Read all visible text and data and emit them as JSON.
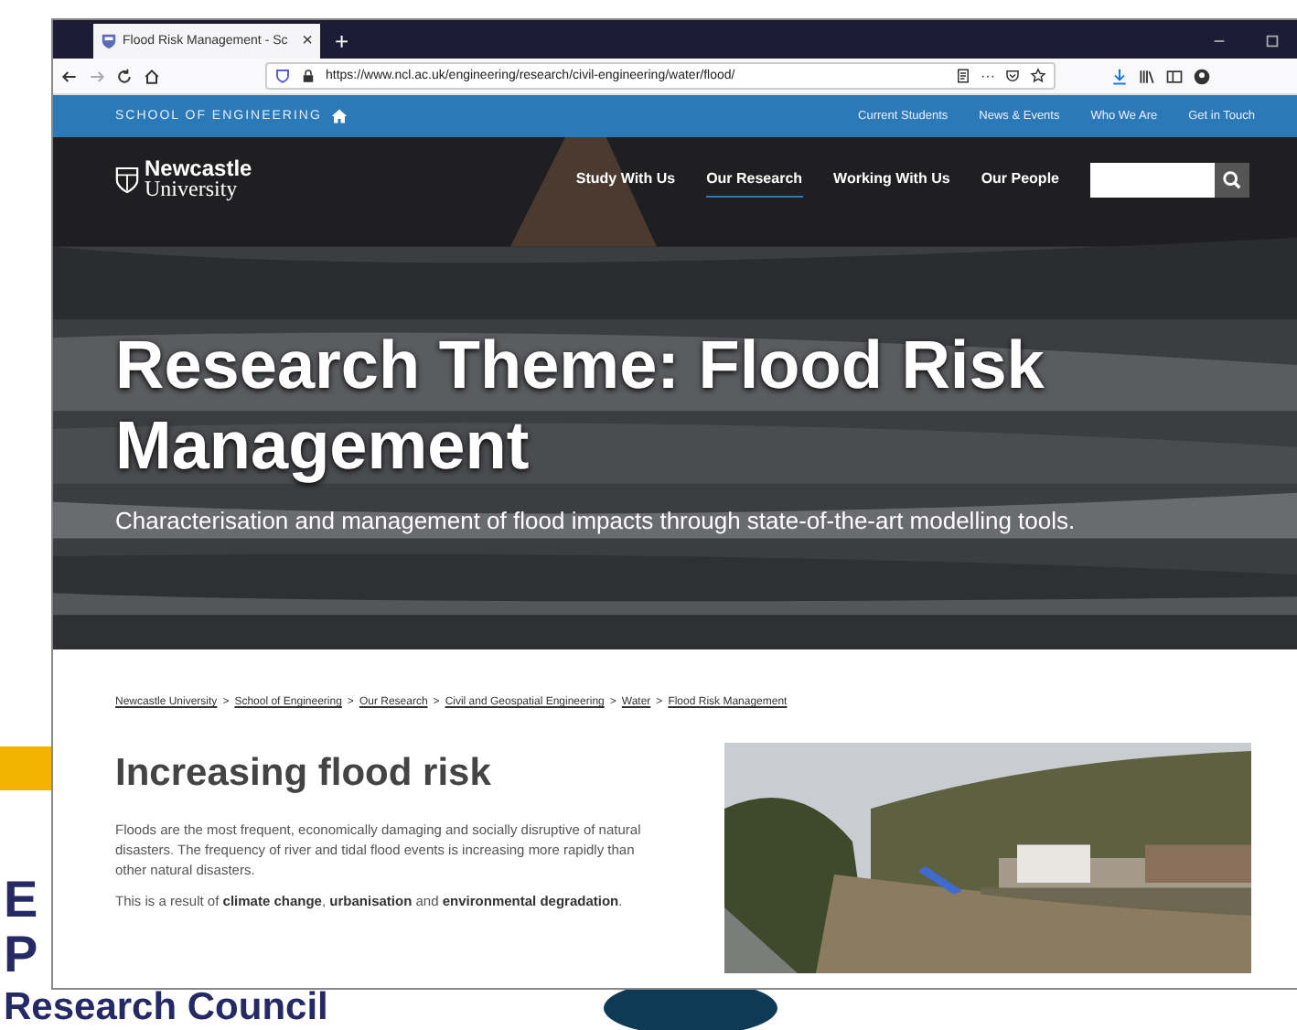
{
  "slide": {
    "texts": [
      "E",
      "P",
      "Research Council"
    ]
  },
  "browser": {
    "tab_title": "Flood Risk Management - Sc",
    "tab_close": "×",
    "new_tab": "+",
    "url": "https://www.ncl.ac.uk/engineering/research/civil-engineering/water/flood/",
    "more": "···"
  },
  "top_bar": {
    "school": "SCHOOL OF ENGINEERING",
    "links": [
      "Current Students",
      "News & Events",
      "Who We Are",
      "Get in Touch"
    ]
  },
  "header": {
    "logo_line1": "Newcastle",
    "logo_line2": "University",
    "nav": [
      {
        "label": "Study With Us",
        "selected": false
      },
      {
        "label": "Our Research",
        "selected": true
      },
      {
        "label": "Working With Us",
        "selected": false
      },
      {
        "label": "Our People",
        "selected": false
      }
    ]
  },
  "hero": {
    "title": "Research Theme: Flood Risk Management",
    "subtitle": "Characterisation and management of flood impacts through state-of-the-art modelling tools."
  },
  "breadcrumb": {
    "separator": ">",
    "items": [
      "Newcastle University",
      "School of Engineering",
      "Our Research",
      "Civil and Geospatial Engineering",
      "Water",
      "Flood Risk Management"
    ]
  },
  "section": {
    "heading": "Increasing flood risk",
    "paragraphs": [
      "Floods are the most frequent, economically damaging and socially disruptive of natural disasters. The frequency of river and tidal flood events is increasing more rapidly than other natural disasters.",
      "This is a result of **climate change**, **urbanisation** and **environmental degradation**."
    ]
  }
}
